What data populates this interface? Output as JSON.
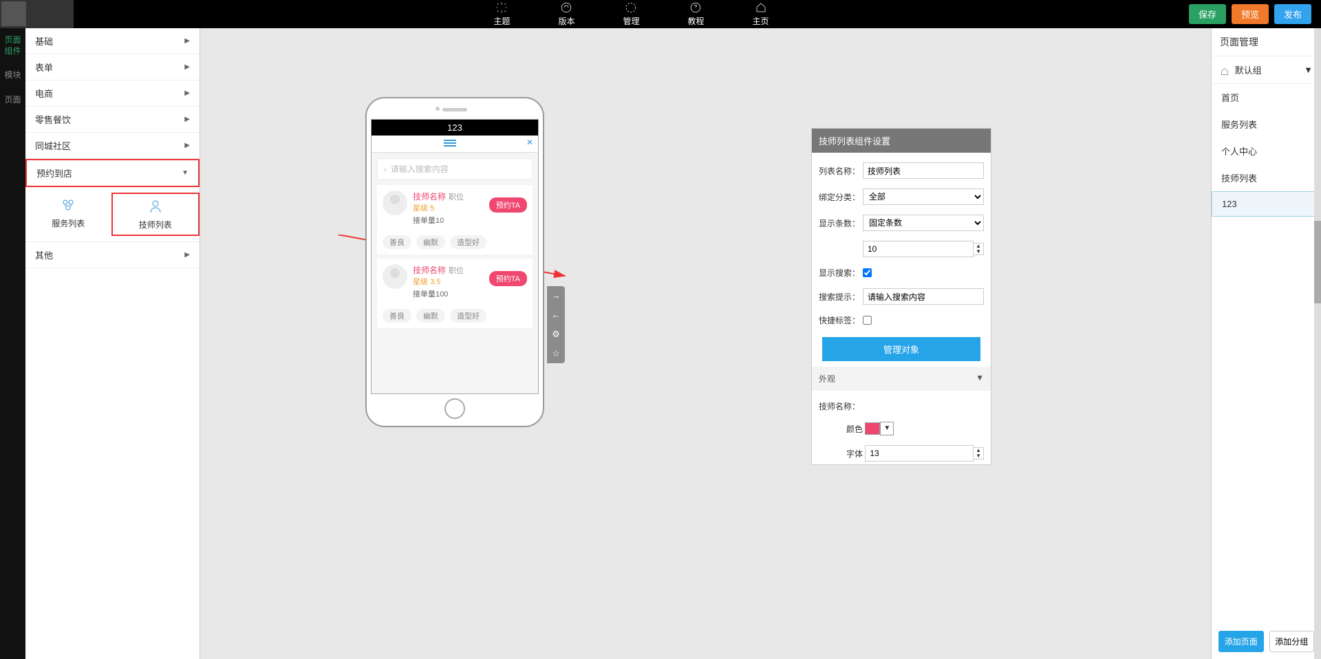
{
  "topnav": {
    "theme": "主题",
    "version": "版本",
    "manage": "管理",
    "tutorial": "教程",
    "home": "主页"
  },
  "topbtn": {
    "save": "保存",
    "preview": "预览",
    "publish": "发布"
  },
  "lefttabs": {
    "components": "页面\n组件",
    "modules": "模块",
    "pages": "页面"
  },
  "accordion": {
    "basic": "基础",
    "form": "表单",
    "ecommerce": "电商",
    "retail": "零售餐饮",
    "community": "同城社区",
    "booking": "预约到店",
    "other": "其他"
  },
  "subitems": {
    "service_list": "服务列表",
    "tech_list": "技师列表"
  },
  "phone": {
    "title": "123",
    "search_placeholder": "请输入搜索内容",
    "cards": [
      {
        "name": "技师名称",
        "pos": "职位",
        "star_label": "星级",
        "star": "5",
        "orders_label": "接单量",
        "orders": "10",
        "book": "预约TA",
        "tags": [
          "善良",
          "幽默",
          "造型好"
        ]
      },
      {
        "name": "技师名称",
        "pos": "职位",
        "star_label": "星级",
        "star": "3.5",
        "orders_label": "接单量",
        "orders": "100",
        "book": "预约TA",
        "tags": [
          "善良",
          "幽默",
          "造型好"
        ]
      }
    ]
  },
  "settings": {
    "title": "技师列表组件设置",
    "list_name_label": "列表名称：",
    "list_name_value": "技师列表",
    "category_label": "绑定分类：",
    "category_value": "全部",
    "count_label": "显示条数：",
    "count_mode": "固定条数",
    "count_value": "10",
    "show_search_label": "显示搜索：",
    "search_hint_label": "搜索提示：",
    "search_hint_value": "请输入搜索内容",
    "quick_tag_label": "快捷标签：",
    "manage_btn": "管理对象",
    "appearance": "外观",
    "tech_name_label": "技师名称：",
    "color_label": "颜色",
    "font_label": "字体",
    "font_value": "13"
  },
  "pagepanel": {
    "title": "页面管理",
    "group": "默认组",
    "items": [
      "首页",
      "服务列表",
      "个人中心",
      "技师列表",
      "123"
    ],
    "add_page": "添加页面",
    "add_group": "添加分组"
  }
}
